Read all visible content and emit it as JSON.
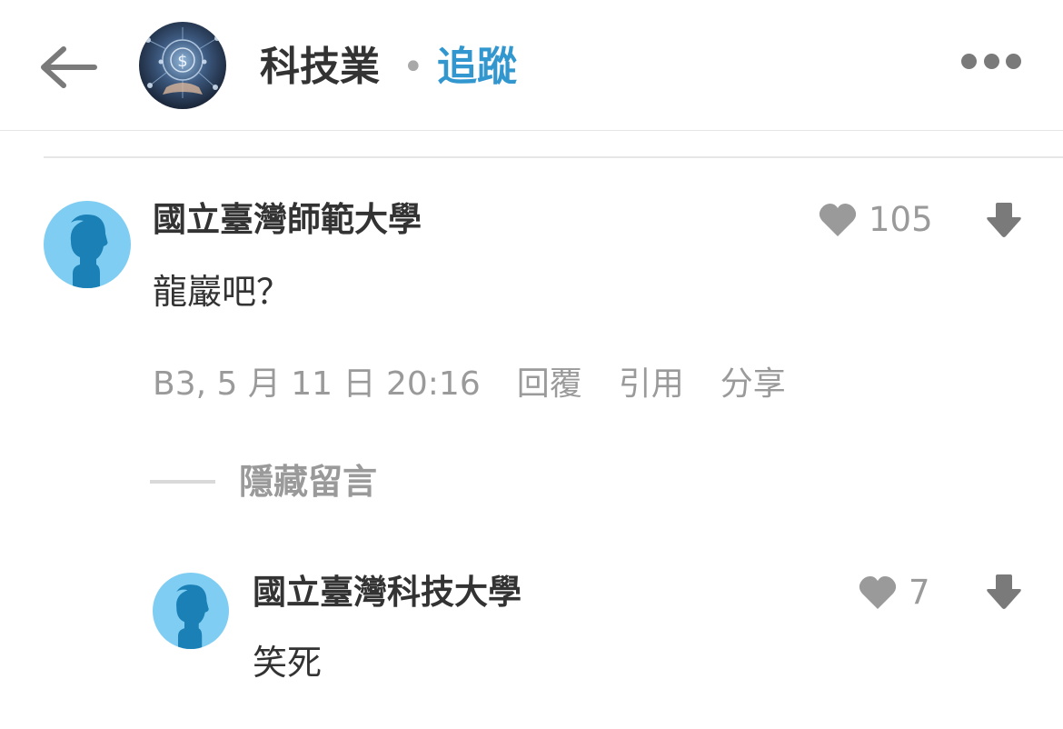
{
  "header": {
    "forum_name": "科技業",
    "separator": "•",
    "follow_label": "追蹤"
  },
  "comments": [
    {
      "author": "國立臺灣師範大學",
      "text": "龍巖吧？",
      "likes": "105",
      "floor_time": "B3, 5 月 11 日 20:16",
      "actions": [
        "回覆",
        "引用",
        "分享"
      ],
      "hide_label": "隱藏留言"
    },
    {
      "author": "國立臺灣科技大學",
      "text": "笑死",
      "likes": "7"
    }
  ],
  "colors": {
    "accent": "#3397cf",
    "avatar_bg": "#7fcdf2",
    "avatar_fg": "#1a80b6",
    "muted": "#9a9a9a"
  },
  "icons": [
    "back-arrow-icon",
    "more-dots-icon",
    "heart-icon",
    "downvote-arrow-icon",
    "user-avatar-icon"
  ]
}
